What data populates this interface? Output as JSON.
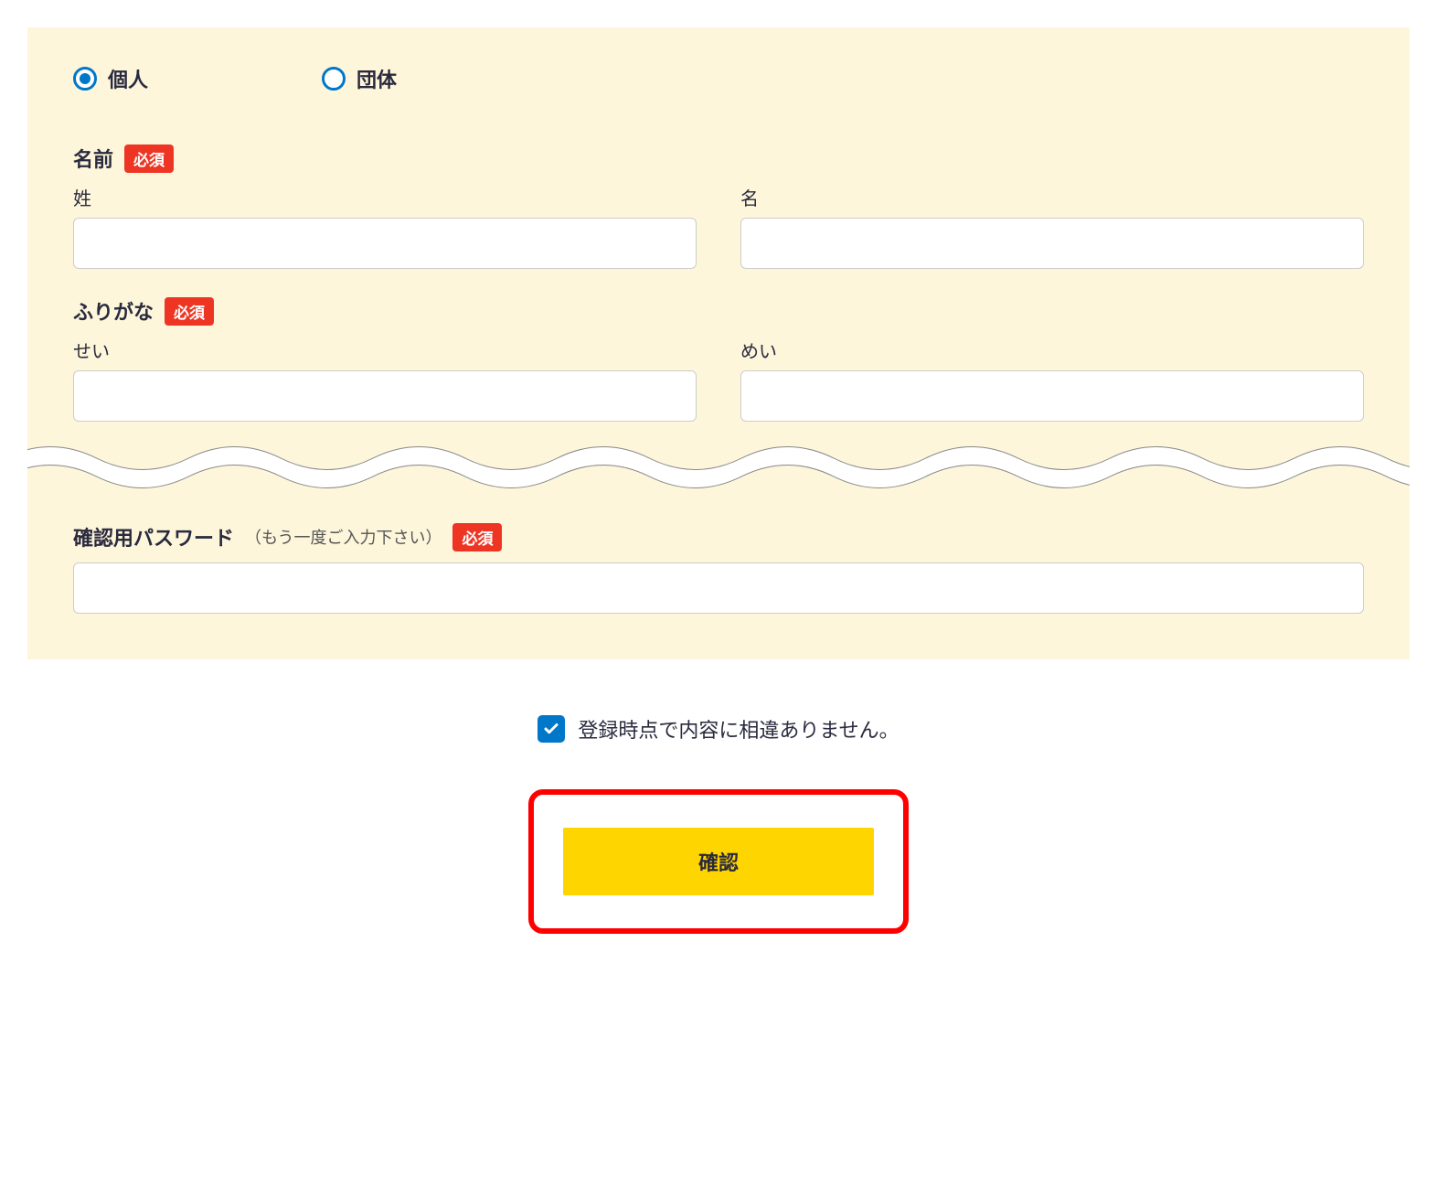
{
  "radios": {
    "individual": "個人",
    "group": "団体"
  },
  "required_badge": "必須",
  "name_section": {
    "title": "名前",
    "last_label": "姓",
    "first_label": "名"
  },
  "furigana_section": {
    "title": "ふりがな",
    "last_label": "せい",
    "first_label": "めい"
  },
  "password_confirm_section": {
    "title": "確認用パスワード",
    "subtitle": "（もう一度ご入力下さい）"
  },
  "checkbox_label": "登録時点で内容に相違ありません。",
  "confirm_button": "確認"
}
